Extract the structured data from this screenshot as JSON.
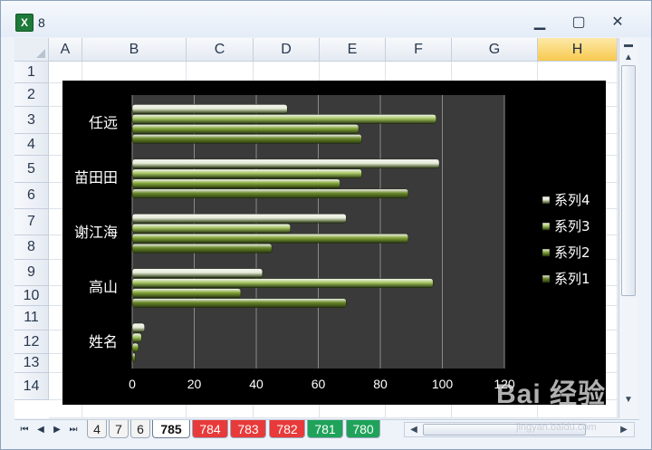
{
  "window": {
    "title": "8",
    "app_icon": "excel-icon"
  },
  "columns": [
    "A",
    "B",
    "C",
    "D",
    "E",
    "F",
    "G",
    "H"
  ],
  "rows": [
    "1",
    "2",
    "3",
    "4",
    "5",
    "6",
    "7",
    "8",
    "9",
    "10",
    "11",
    "12",
    "13",
    "14"
  ],
  "selected_column": "H",
  "sheet_tabs": [
    {
      "label": "4",
      "color": "#f3f3f3",
      "text_color": "#222222",
      "active": false
    },
    {
      "label": "7",
      "color": "#f3f3f3",
      "text_color": "#222222",
      "active": false
    },
    {
      "label": "6",
      "color": "#f3f3f3",
      "text_color": "#222222",
      "active": false
    },
    {
      "label": "785",
      "color": "#ffffff",
      "text_color": "#111111",
      "active": true
    },
    {
      "label": "784",
      "color": "#e83a3a",
      "text_color": "#ffffff",
      "active": false
    },
    {
      "label": "783",
      "color": "#e83a3a",
      "text_color": "#ffffff",
      "active": false
    },
    {
      "label": "782",
      "color": "#e83a3a",
      "text_color": "#ffffff",
      "active": false
    },
    {
      "label": "781",
      "color": "#1fa35a",
      "text_color": "#ffffff",
      "active": false
    },
    {
      "label": "780",
      "color": "#1fa35a",
      "text_color": "#ffffff",
      "active": false
    }
  ],
  "watermark": {
    "text": "Bai 经验",
    "sub": "jingyan.baidu.com"
  },
  "chart_data": {
    "type": "bar",
    "orientation": "horizontal",
    "categories": [
      "姓名",
      "高山",
      "谢江海",
      "苗田田",
      "任远"
    ],
    "series": [
      {
        "name": "系列1",
        "values": [
          1,
          69,
          45,
          89,
          74
        ],
        "color": "#6b8a2a"
      },
      {
        "name": "系列2",
        "values": [
          2,
          35,
          89,
          67,
          73
        ],
        "color": "#86a83a"
      },
      {
        "name": "系列3",
        "values": [
          3,
          97,
          51,
          74,
          98
        ],
        "color": "#a7c763"
      },
      {
        "name": "系列4",
        "values": [
          4,
          42,
          69,
          99,
          50
        ],
        "color": "#e6ecd6"
      }
    ],
    "x_ticks": [
      "0",
      "20",
      "40",
      "60",
      "80",
      "100",
      "120"
    ],
    "xlim": [
      0,
      120
    ],
    "grid": true,
    "legend_position": "right",
    "background": "#000000",
    "plot_background": "#3a3a3a"
  }
}
